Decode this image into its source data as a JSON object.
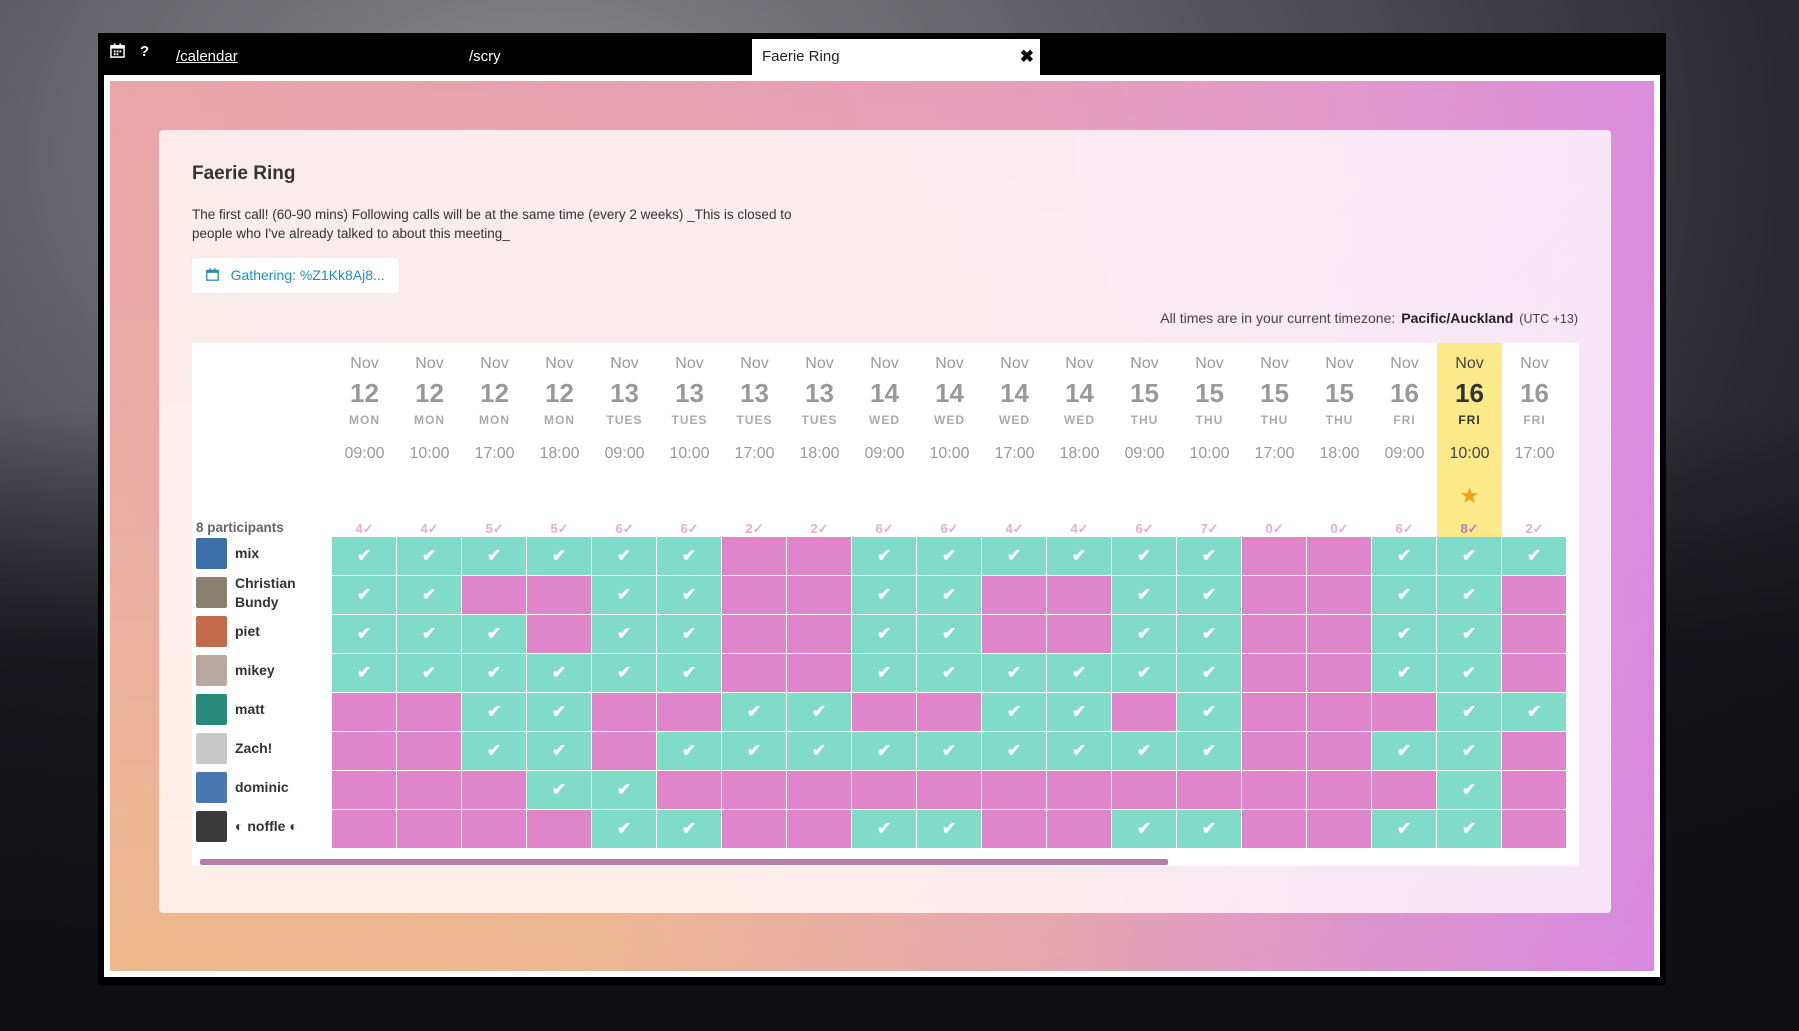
{
  "tabbar": {
    "calendar_icon": "calendar-icon",
    "help_icon": "?",
    "tabs": [
      {
        "label": "/calendar"
      },
      {
        "label": "/scry"
      },
      {
        "label": "Faerie Ring",
        "close": "✖"
      }
    ]
  },
  "event": {
    "title": "Faerie Ring",
    "description": "The first call! (60-90 mins) Following calls will be at the same time (every 2 weeks) _This is closed to people who I've already talked to about this meeting_",
    "gathering_label": "Gathering: %Z1Kk8Aj8...",
    "tz_prefix": "All times are in your current timezone:",
    "tz_name": "Pacific/Auckland",
    "tz_offset": "(UTC +13)"
  },
  "participants_label": "8 participants",
  "colors": {
    "available": "#80dcc9",
    "unavailable": "#e085cc",
    "highlight": "#fbe98a",
    "star": "#f29e1f"
  },
  "slots": [
    {
      "month": "Nov",
      "day": "12",
      "dow": "MON",
      "time": "09:00",
      "count": "4✓"
    },
    {
      "month": "Nov",
      "day": "12",
      "dow": "MON",
      "time": "10:00",
      "count": "4✓"
    },
    {
      "month": "Nov",
      "day": "12",
      "dow": "MON",
      "time": "17:00",
      "count": "5✓"
    },
    {
      "month": "Nov",
      "day": "12",
      "dow": "MON",
      "time": "18:00",
      "count": "5✓"
    },
    {
      "month": "Nov",
      "day": "13",
      "dow": "TUES",
      "time": "09:00",
      "count": "6✓"
    },
    {
      "month": "Nov",
      "day": "13",
      "dow": "TUES",
      "time": "10:00",
      "count": "6✓"
    },
    {
      "month": "Nov",
      "day": "13",
      "dow": "TUES",
      "time": "17:00",
      "count": "2✓"
    },
    {
      "month": "Nov",
      "day": "13",
      "dow": "TUES",
      "time": "18:00",
      "count": "2✓"
    },
    {
      "month": "Nov",
      "day": "14",
      "dow": "WED",
      "time": "09:00",
      "count": "6✓"
    },
    {
      "month": "Nov",
      "day": "14",
      "dow": "WED",
      "time": "10:00",
      "count": "6✓"
    },
    {
      "month": "Nov",
      "day": "14",
      "dow": "WED",
      "time": "17:00",
      "count": "4✓"
    },
    {
      "month": "Nov",
      "day": "14",
      "dow": "WED",
      "time": "18:00",
      "count": "4✓"
    },
    {
      "month": "Nov",
      "day": "15",
      "dow": "THU",
      "time": "09:00",
      "count": "6✓"
    },
    {
      "month": "Nov",
      "day": "15",
      "dow": "THU",
      "time": "10:00",
      "count": "7✓"
    },
    {
      "month": "Nov",
      "day": "15",
      "dow": "THU",
      "time": "17:00",
      "count": "0✓"
    },
    {
      "month": "Nov",
      "day": "15",
      "dow": "THU",
      "time": "18:00",
      "count": "0✓"
    },
    {
      "month": "Nov",
      "day": "16",
      "dow": "FRI",
      "time": "09:00",
      "count": "6✓"
    },
    {
      "month": "Nov",
      "day": "16",
      "dow": "FRI",
      "time": "10:00",
      "count": "8✓",
      "highlight": true,
      "star": "★"
    },
    {
      "month": "Nov",
      "day": "16",
      "dow": "FRI",
      "time": "17:00",
      "count": "2✓"
    }
  ],
  "people": [
    {
      "name": "mix",
      "avatar_color": "#3b6fa8",
      "editable": true,
      "avail": [
        1,
        1,
        1,
        1,
        1,
        1,
        0,
        0,
        1,
        1,
        1,
        1,
        1,
        1,
        0,
        0,
        1,
        1,
        1
      ]
    },
    {
      "name": "Christian Bundy",
      "avatar_color": "#8a8070",
      "avail": [
        1,
        1,
        0,
        0,
        1,
        1,
        0,
        0,
        1,
        1,
        0,
        0,
        1,
        1,
        0,
        0,
        1,
        1,
        0
      ]
    },
    {
      "name": "piet",
      "avatar_color": "#c26a4a",
      "avail": [
        1,
        1,
        1,
        0,
        1,
        1,
        0,
        0,
        1,
        1,
        0,
        0,
        1,
        1,
        0,
        0,
        1,
        1,
        0
      ]
    },
    {
      "name": "mikey",
      "avatar_color": "#b8a8a0",
      "avail": [
        1,
        1,
        1,
        1,
        1,
        1,
        0,
        0,
        1,
        1,
        1,
        1,
        1,
        1,
        0,
        0,
        1,
        1,
        0
      ]
    },
    {
      "name": "matt",
      "avatar_color": "#2a8a7a",
      "avail": [
        0,
        0,
        1,
        1,
        0,
        0,
        1,
        1,
        0,
        0,
        1,
        1,
        0,
        1,
        0,
        0,
        0,
        1,
        1
      ]
    },
    {
      "name": "Zach!",
      "avatar_color": "#c8c8c8",
      "avail": [
        0,
        0,
        1,
        1,
        0,
        1,
        1,
        1,
        1,
        1,
        1,
        1,
        1,
        1,
        0,
        0,
        1,
        1,
        0
      ]
    },
    {
      "name": "dominic",
      "avatar_color": "#4a78b0",
      "avail": [
        0,
        0,
        0,
        1,
        1,
        0,
        0,
        0,
        0,
        0,
        0,
        0,
        0,
        0,
        0,
        0,
        0,
        1,
        0
      ]
    },
    {
      "name": "◐ noffle ◐",
      "avatar_color": "#3a3a3a",
      "avail": [
        0,
        0,
        0,
        0,
        1,
        1,
        0,
        0,
        1,
        1,
        0,
        0,
        1,
        1,
        0,
        0,
        1,
        1,
        0
      ]
    }
  ],
  "check_glyph": "✔"
}
